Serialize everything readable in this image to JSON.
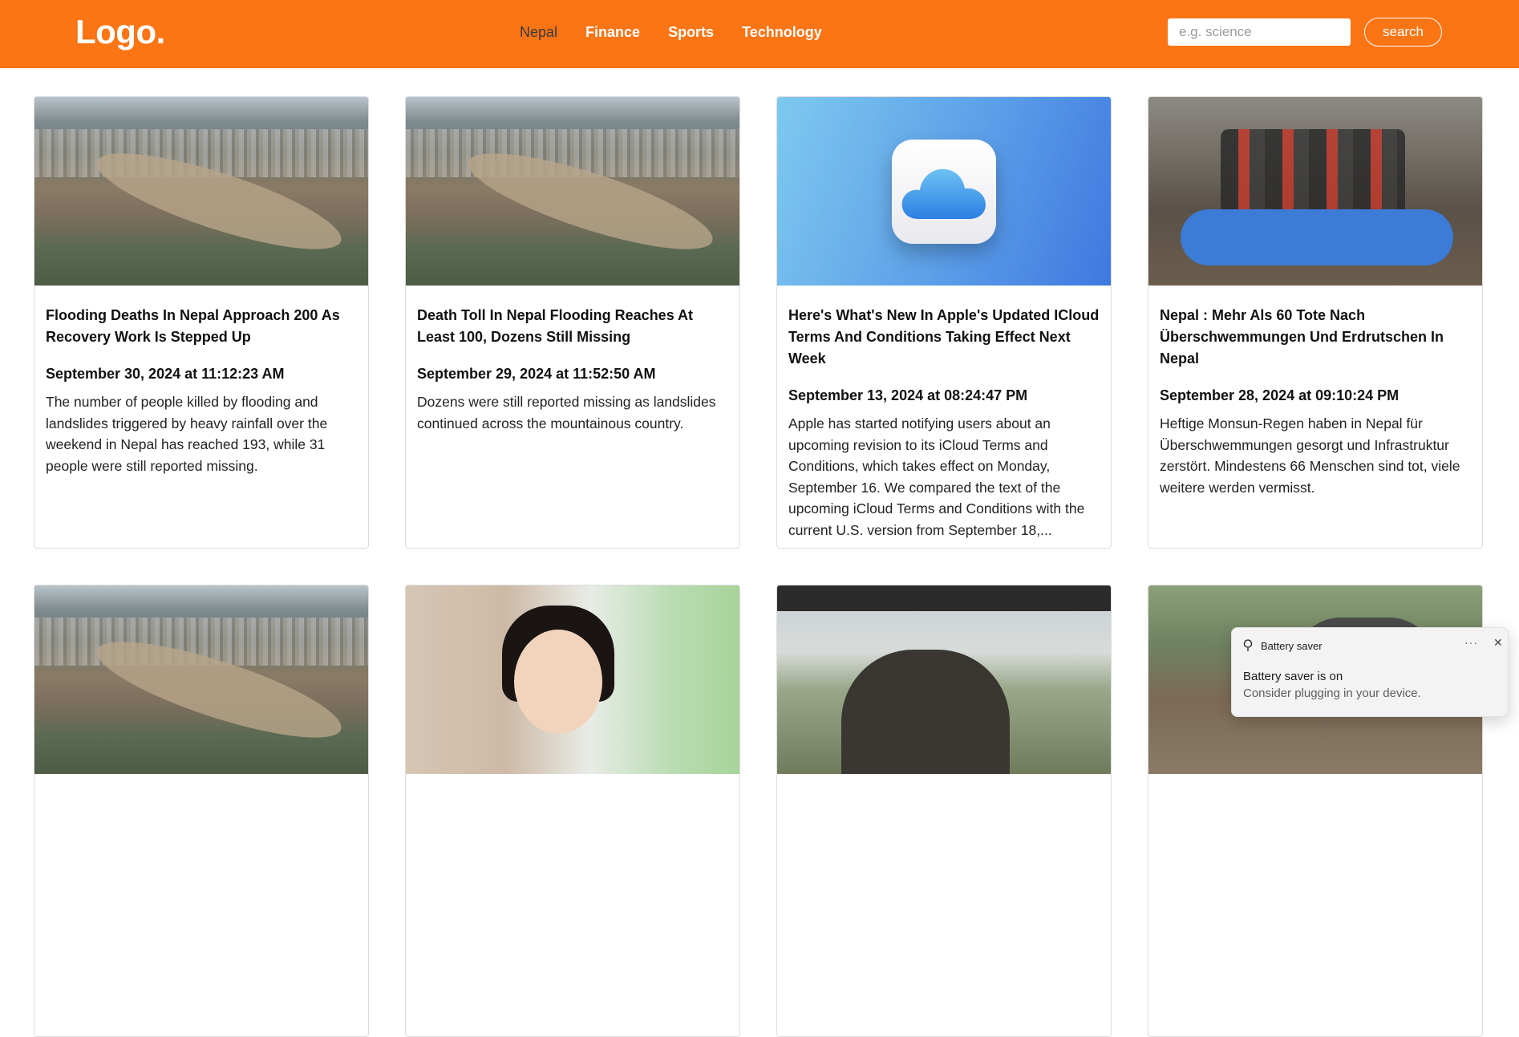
{
  "header": {
    "logo": "Logo.",
    "nav": [
      {
        "label": "Nepal"
      },
      {
        "label": "Finance"
      },
      {
        "label": "Sports"
      },
      {
        "label": "Technology"
      }
    ],
    "search": {
      "placeholder": "e.g. science",
      "value": "",
      "button_label": "search"
    }
  },
  "cards": [
    {
      "title": "Flooding Deaths In Nepal Approach 200 As Recovery Work Is Stepped Up",
      "date": "September 30, 2024 at 11:12:23 AM",
      "description": "The number of people killed by flooding and landslides triggered by heavy rainfall over the weekend in Nepal has reached 193, while 31 people were still reported missing."
    },
    {
      "title": "Death Toll In Nepal Flooding Reaches At Least 100, Dozens Still Missing",
      "date": "September 29, 2024 at 11:52:50 AM",
      "description": "Dozens were still reported missing as landslides continued across the mountainous country."
    },
    {
      "title": "Here's What's New In Apple's Updated ICloud Terms And Conditions Taking Effect Next Week",
      "date": "September 13, 2024 at 08:24:47 PM",
      "description": "Apple has started notifying users about an upcoming revision to its iCloud Terms and Conditions, which takes effect on Monday, September 16. We compared the text of the upcoming iCloud Terms and Conditions with the current U.S. version from September 18,..."
    },
    {
      "title": "Nepal : Mehr Als 60 Tote Nach Überschwemmungen Und Erdrutschen In Nepal",
      "date": "September 28, 2024 at 09:10:24 PM",
      "description": "Heftige Monsun-Regen haben in Nepal für Überschwemmungen gesorgt und Infrastruktur zerstört. Mindestens 66 Menschen sind tot, viele weitere werden vermisst."
    },
    {
      "title": "",
      "date": "",
      "description": ""
    },
    {
      "title": "",
      "date": "",
      "description": ""
    },
    {
      "title": "",
      "date": "",
      "description": ""
    },
    {
      "title": "",
      "date": "",
      "description": ""
    }
  ],
  "toast": {
    "app": "Battery saver",
    "more_icon": "···",
    "close_icon": "✕",
    "title": "Battery saver is on",
    "message": "Consider plugging in your device."
  },
  "colors": {
    "navbar": "#fb7515",
    "nav_active": "#3a3a3a",
    "card_border": "#dcdcdc",
    "toast_bg": "#f3f3f3"
  }
}
